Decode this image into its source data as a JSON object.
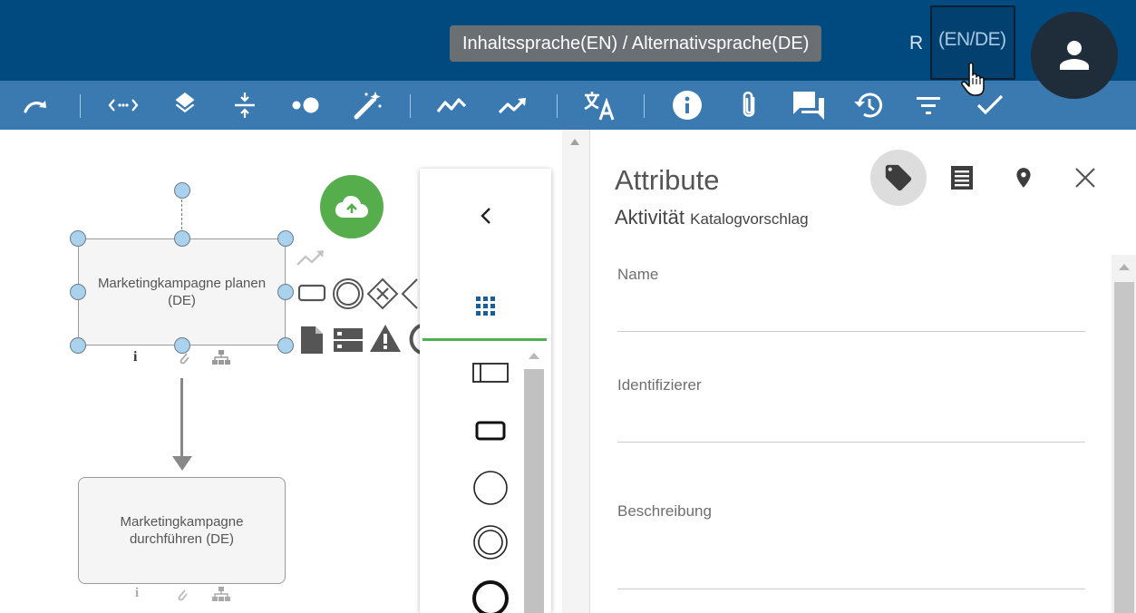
{
  "header": {
    "tooltip": "Inhaltssprache(EN) / Alternativsprache(DE)",
    "obscured_char": "R",
    "language_toggle": "(EN/DE)",
    "avatar_icon": "user-icon",
    "background": "#004a80"
  },
  "toolbar": {
    "background": "#3a7ab1",
    "icons": [
      "redo-icon",
      "code-icon",
      "layers-icon",
      "vertical-align-icon",
      "toggle-icon",
      "magic-wand-icon",
      "trend-icon",
      "trending-up-icon",
      "translate-icon",
      "info-icon",
      "attachment-icon",
      "comments-icon",
      "history-icon",
      "filter-icon",
      "check-icon"
    ]
  },
  "canvas": {
    "task1": {
      "label": "Marketingkampagne planen (DE)"
    },
    "task2": {
      "label": "Marketingkampagne durchführen (DE)"
    },
    "upload_icon": "cloud-upload-icon",
    "task_badges": [
      "info-icon",
      "attachment-icon",
      "hierarchy-icon"
    ]
  },
  "palette": {
    "collapse_icon": "chevron-left-icon",
    "tab_icon": "grid-icon",
    "accent": "#4caf50",
    "shapes": [
      "pool-shape",
      "task-shape",
      "start-event-shape",
      "intermediate-event-shape",
      "end-event-shape"
    ]
  },
  "panel": {
    "title": "Attribute",
    "subtitle": "Aktivität",
    "subtitle_tag": "Katalogvorschlag",
    "header_icons": [
      "tag-icon",
      "document-icon",
      "location-icon",
      "close-icon"
    ],
    "fields": [
      {
        "label": "Name",
        "value": ""
      },
      {
        "label": "Identifizierer",
        "value": ""
      },
      {
        "label": "Beschreibung",
        "value": ""
      }
    ]
  }
}
